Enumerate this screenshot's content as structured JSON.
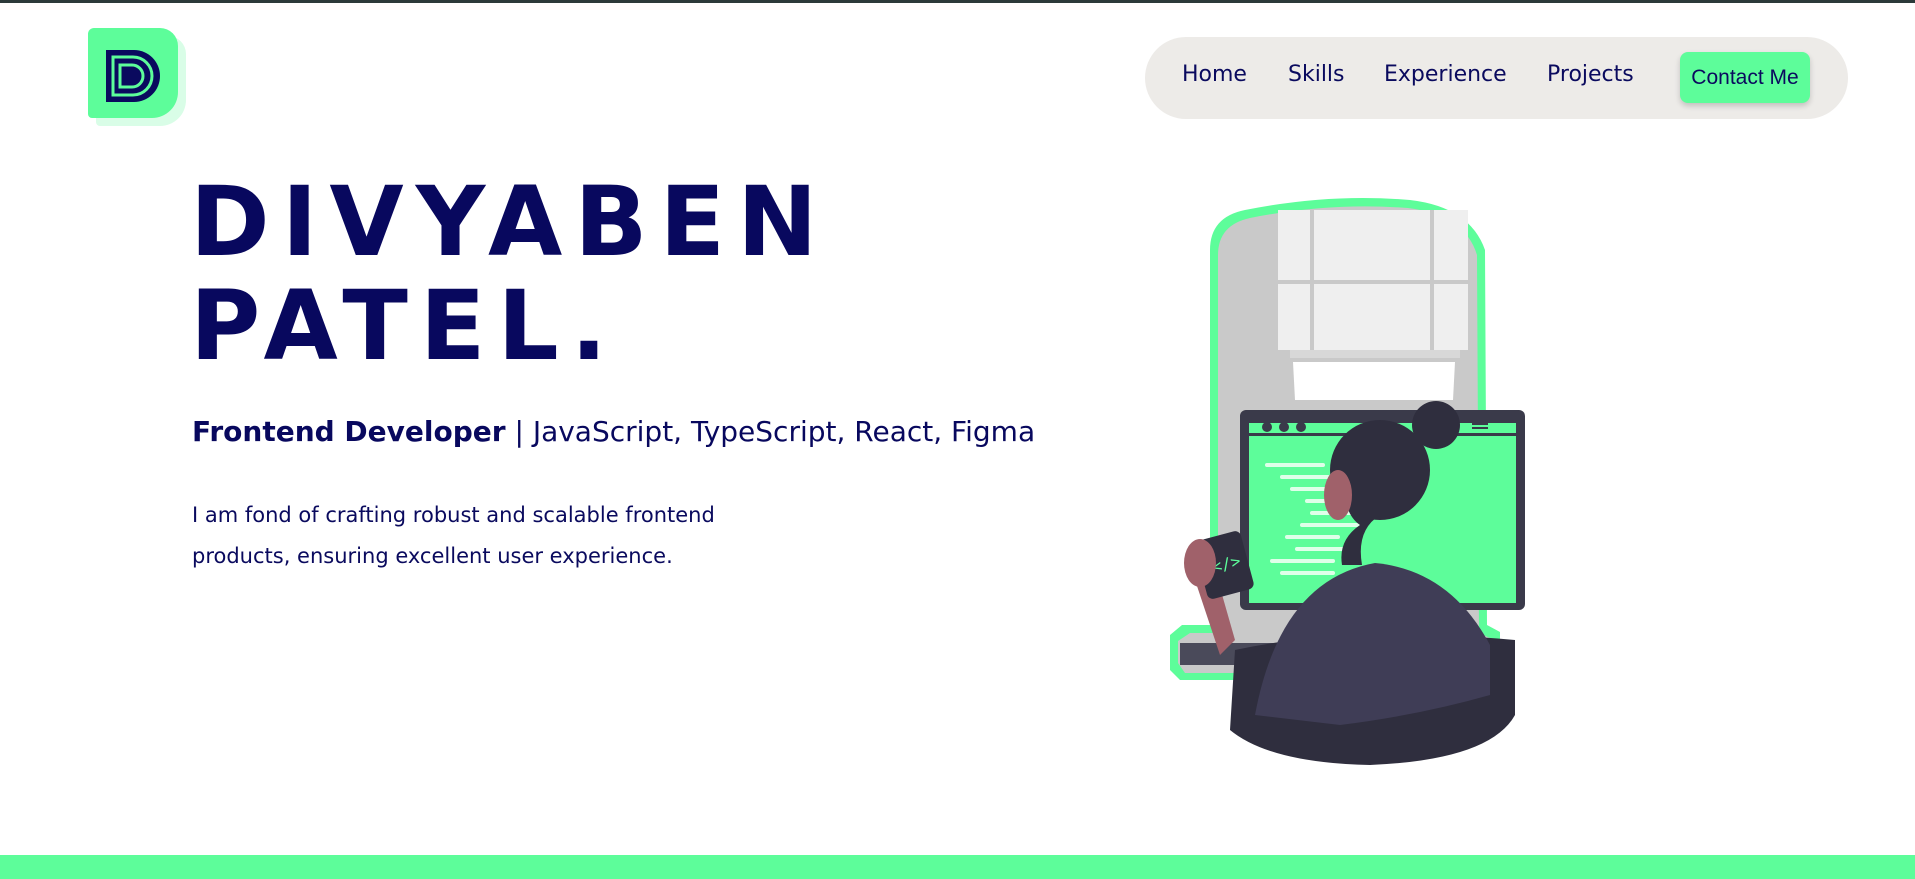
{
  "logo": {
    "letter": "D",
    "icon": "d-monogram-logo"
  },
  "nav": {
    "items": [
      "Home",
      "Skills",
      "Experience",
      "Projects"
    ],
    "contact_label": "Contact Me"
  },
  "hero": {
    "name_line1": "DIVYABEN",
    "name_line2": "PATEL.",
    "role": "Frontend Developer",
    "separator": " | ",
    "skills": "JavaScript, TypeScript, React, Figma",
    "description": "I am fond of crafting robust and scalable frontend products, ensuring excellent user experience."
  },
  "illustration": {
    "icon": "developer-at-computer-illustration",
    "mug_code_symbol": "</>"
  },
  "colors": {
    "accent": "#5dfd9a",
    "text": "#08085e",
    "nav_bg": "#edebe8"
  }
}
